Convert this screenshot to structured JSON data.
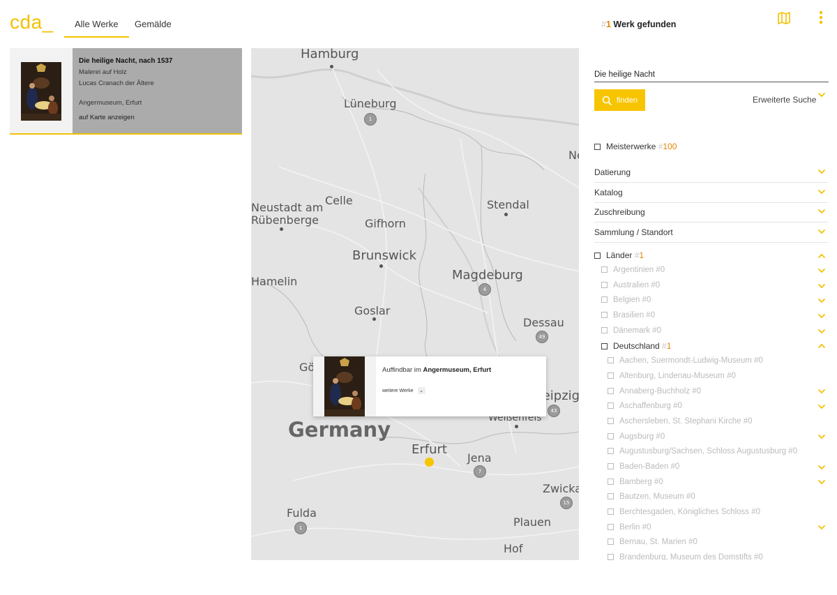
{
  "header": {
    "logo": "cda_",
    "tabs": [
      {
        "label": "Alle Werke",
        "active": true
      },
      {
        "label": "Gemälde",
        "active": false
      }
    ],
    "result_hash": "#",
    "result_num": "1",
    "result_text": " Werk gefunden"
  },
  "card": {
    "title": "Die heilige Nacht, nach 1537",
    "medium": "Malerei auf Holz",
    "artist": "Lucas Cranach der Ältere",
    "location": "Angermuseum, Erfurt",
    "link": "auf Karte anzeigen"
  },
  "map": {
    "cities": [
      {
        "name": "Hamburg",
        "big": true
      },
      {
        "name": "Lüneburg"
      },
      {
        "name": "Celle"
      },
      {
        "name": "Stendal"
      },
      {
        "name": "Neustadt am"
      },
      {
        "name": "Rübenberge"
      },
      {
        "name": "Gifhorn"
      },
      {
        "name": "Brunswick",
        "big": true
      },
      {
        "name": "Magdeburg",
        "big": true
      },
      {
        "name": "Hamelin"
      },
      {
        "name": "Goslar"
      },
      {
        "name": "Dessau"
      },
      {
        "name": "Gö"
      },
      {
        "name": "Leipzig"
      },
      {
        "name": "Weißenfels"
      },
      {
        "name": "Germany"
      },
      {
        "name": "Erfurt",
        "big": true
      },
      {
        "name": "Jena"
      },
      {
        "name": "Zwickau"
      },
      {
        "name": "Fulda"
      },
      {
        "name": "Plauen"
      },
      {
        "name": "Hof"
      },
      {
        "name": "Ne"
      }
    ],
    "clusters": [
      "1",
      "4",
      "49",
      "43",
      "7",
      "15",
      "1"
    ],
    "popup": {
      "prefix": "Auffindbar im ",
      "place": "Angermuseum, Erfurt",
      "more": "weitere Werke",
      "dropdown": "⌄"
    }
  },
  "search": {
    "value": "Die heilige Nacht",
    "find_label": "finden",
    "advanced_label": "Erweiterte Suche"
  },
  "filters": {
    "masterworks": {
      "label": "Meisterwerke ",
      "hash": "#",
      "num": "100"
    },
    "sections": [
      "Datierung",
      "Katalog",
      "Zuschreibung",
      "Sammlung / Standort"
    ],
    "countries_label": {
      "label": "Länder ",
      "hash": "#",
      "num": "1"
    },
    "countries": [
      {
        "label": "Argentinien #0"
      },
      {
        "label": "Australien #0"
      },
      {
        "label": "Belgien #0"
      },
      {
        "label": "Brasilien #0"
      },
      {
        "label": "Dänemark #0"
      }
    ],
    "germany": {
      "label": "Deutschland ",
      "hash": "#",
      "num": "1"
    },
    "places": [
      {
        "label": "Aachen, Suermondt-Ludwig-Museum #0",
        "chev": false
      },
      {
        "label": "Altenburg, Lindenau-Museum #0",
        "chev": false
      },
      {
        "label": "Annaberg-Buchholz #0",
        "chev": true
      },
      {
        "label": "Aschaffenburg #0",
        "chev": true
      },
      {
        "label": "Aschersleben, St. Stephani Kirche #0",
        "chev": false
      },
      {
        "label": "Augsburg #0",
        "chev": true
      },
      {
        "label": "Augustusburg/Sachsen, Schloss Augustusburg #0",
        "chev": false
      },
      {
        "label": "Baden-Baden #0",
        "chev": true
      },
      {
        "label": "Bamberg #0",
        "chev": true
      },
      {
        "label": "Bautzen, Museum #0",
        "chev": false
      },
      {
        "label": "Berchtesgaden, Königliches Schloss #0",
        "chev": false
      },
      {
        "label": "Berlin #0",
        "chev": true
      },
      {
        "label": "Bernau, St. Marien #0",
        "chev": false
      },
      {
        "label": "Brandenburg, Museum des Domstifts #0",
        "chev": false
      }
    ]
  },
  "colors": {
    "accent": "#f7c400",
    "count": "#e08400"
  },
  "icons": [
    "map-icon",
    "more-vertical-icon",
    "search-icon",
    "chevron-down-icon",
    "chevron-up-icon"
  ]
}
